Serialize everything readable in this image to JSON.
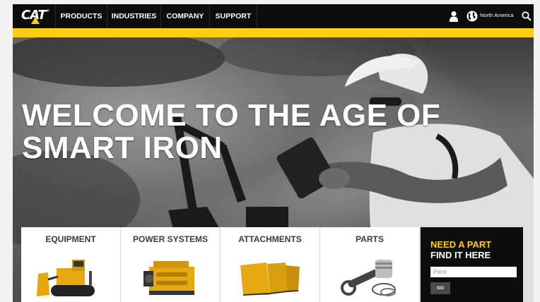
{
  "nav": {
    "logo_text": "CAT",
    "logo_tm": "®",
    "items": [
      {
        "label": "PRODUCTS"
      },
      {
        "label": "INDUSTRIES"
      },
      {
        "label": "COMPANY"
      },
      {
        "label": "SUPPORT"
      }
    ],
    "region": "North America",
    "icons": [
      "user-icon",
      "globe-icon",
      "search-icon"
    ]
  },
  "hero": {
    "headline_line1": "WELCOME TO THE AGE OF",
    "headline_line2": "SMART IRON"
  },
  "products": [
    {
      "label": "EQUIPMENT",
      "icon": "bulldozer-icon"
    },
    {
      "label": "POWER SYSTEMS",
      "icon": "engine-icon"
    },
    {
      "label": "ATTACHMENTS",
      "icon": "bucket-icon"
    },
    {
      "label": "PARTS",
      "icon": "piston-icon"
    }
  ],
  "part_finder": {
    "title_line1": "NEED A PART",
    "title_line2": "FIND IT HERE",
    "input_placeholder": "Part#",
    "input_value": "",
    "button_label": "GO"
  },
  "colors": {
    "brand_yellow": "#ffcd11",
    "nav_bg": "#0c0c0c",
    "card_bg": "#ffffff",
    "part_box_bg": "#0d0d0d"
  }
}
